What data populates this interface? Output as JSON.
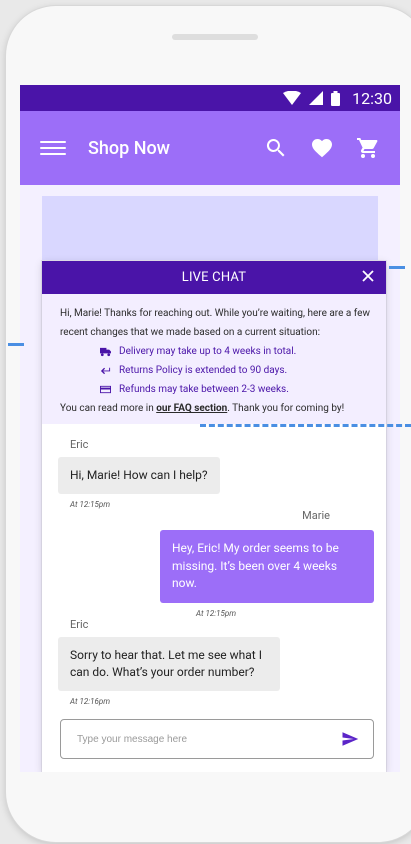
{
  "statusbar": {
    "time": "12:30"
  },
  "appbar": {
    "title": "Shop Now"
  },
  "chat": {
    "header_title": "LIVE CHAT",
    "notice": {
      "intro": "Hi, Marie! Thanks for reaching out. While you’re waiting, here are a few recent changes that we made based on a current situation:",
      "items": [
        {
          "icon": "truck-icon",
          "text": "Delivery may take up to 4 weeks in total."
        },
        {
          "icon": "return-arrow-icon",
          "text": "Returns Policy is extended to 90 days."
        },
        {
          "icon": "credit-card-icon",
          "text": "Refunds may take between 2-3 weeks."
        }
      ],
      "footer_before": "You can read more in ",
      "footer_link": "our FAQ section",
      "footer_after": ". Thank you for coming by!"
    },
    "messages": [
      {
        "from": "Eric",
        "text": "Hi, Marie! How can I help?",
        "time": "At 12:15pm"
      },
      {
        "from": "Marie",
        "text": "Hey, Eric! My order seems to be missing. It’s been over 4 weeks now.",
        "time": "At 12:15pm"
      },
      {
        "from": "Eric",
        "text": "Sorry to hear that. Let me see what I can do. What’s your order number?",
        "time": "At 12:16pm"
      }
    ],
    "composer": {
      "placeholder": "Type your message here"
    }
  },
  "colors": {
    "primary_dark": "#4a14a8",
    "primary": "#9c6ef8",
    "accent": "#5b24c8"
  }
}
